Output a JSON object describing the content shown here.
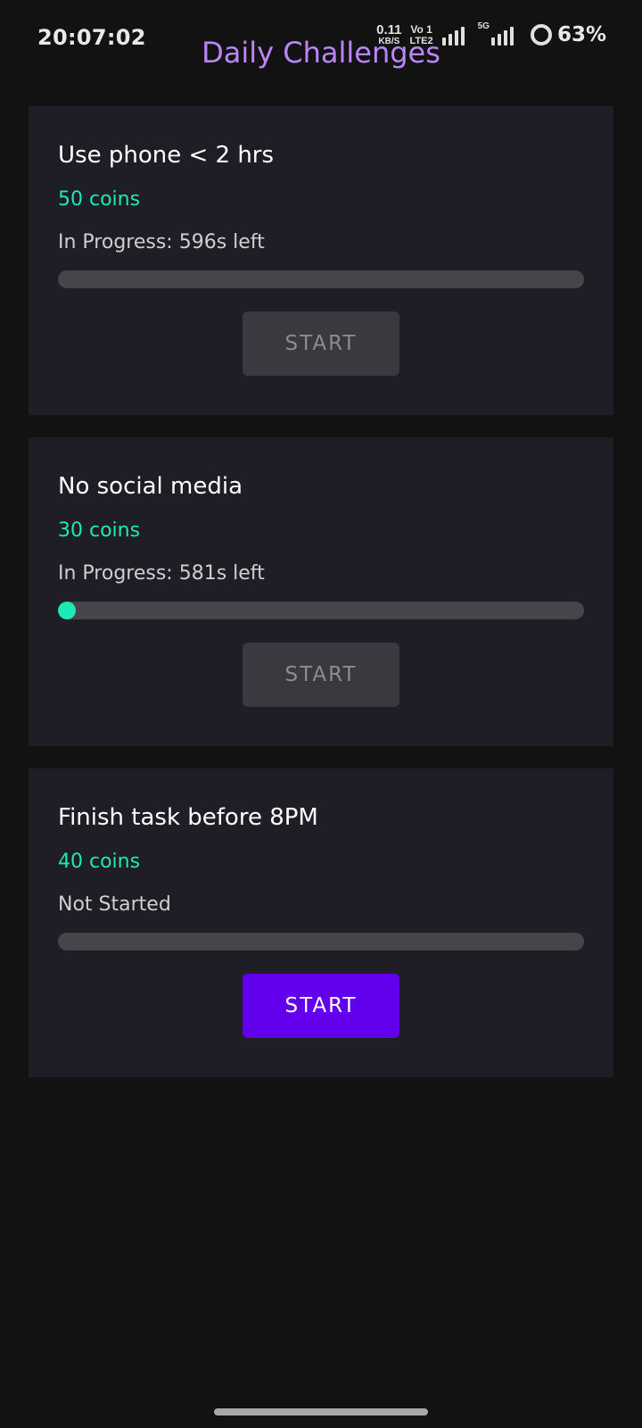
{
  "status_bar": {
    "time": "20:07:02",
    "speed_value": "0.11",
    "speed_unit": "KB/S",
    "volte_top": "Vo 1",
    "volte_bottom": "LTE2",
    "net_type": "5G",
    "battery": "63%"
  },
  "header": {
    "title": "Daily Challenges"
  },
  "challenges": [
    {
      "title": "Use phone < 2 hrs",
      "reward": "50 coins",
      "status": "In Progress: 596s left",
      "progress": 0.0,
      "button": "START",
      "button_enabled": false
    },
    {
      "title": "No social media",
      "reward": "30 coins",
      "status": "In Progress: 581s left",
      "progress": 0.03,
      "button": "START",
      "button_enabled": false
    },
    {
      "title": "Finish task before 8PM",
      "reward": "40 coins",
      "status": "Not Started",
      "progress": 0.0,
      "button": "START",
      "button_enabled": true
    }
  ],
  "colors": {
    "background": "#121212",
    "card": "#1f1d26",
    "title_accent": "#bb86fc",
    "reward": "#1de9b6",
    "primary_button": "#6200ee",
    "disabled_button": "#3a393f"
  }
}
